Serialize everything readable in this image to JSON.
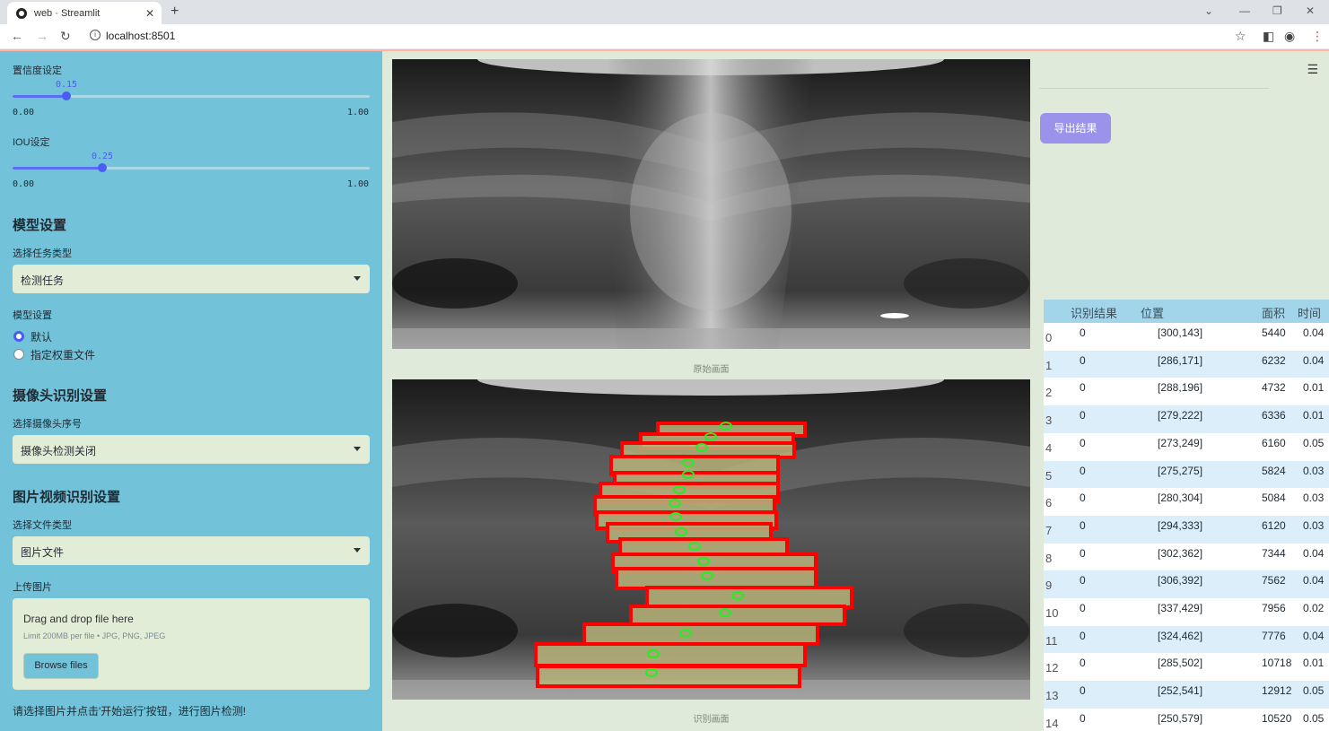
{
  "browser": {
    "tab_title": "web · Streamlit",
    "url": "localhost:8501"
  },
  "sidebar": {
    "conf_label": "置信度设定",
    "conf_value": "0.15",
    "conf_fraction": 0.15,
    "conf_min": "0.00",
    "conf_max": "1.00",
    "iou_label": "IOU设定",
    "iou_value": "0.25",
    "iou_fraction": 0.25,
    "iou_min": "0.00",
    "iou_max": "1.00",
    "model_header": "模型设置",
    "task_label": "选择任务类型",
    "task_value": "检测任务",
    "model_label": "模型设置",
    "model_options": [
      "默认",
      "指定权重文件"
    ],
    "camera_header": "摄像头识别设置",
    "camera_label": "选择摄像头序号",
    "camera_value": "摄像头检测关闭",
    "file_header": "图片视频识别设置",
    "file_type_label": "选择文件类型",
    "file_type_value": "图片文件",
    "upload_label": "上传图片",
    "dropzone_title": "Drag and drop file here",
    "dropzone_sub": "Limit 200MB per file • JPG, PNG, JPEG",
    "browse_label": "Browse files",
    "note": "请选择图片并点击'开始运行'按钮，进行图片检测!"
  },
  "main": {
    "caption_original": "原始画面",
    "caption_result": "识别画面",
    "export_label": "导出结果"
  },
  "table": {
    "headers": [
      "识别结果",
      "位置",
      "面积",
      "时间"
    ],
    "rows": [
      {
        "i": "0",
        "res": "0",
        "pos": "[300,143]",
        "area": "5440",
        "time": "0.04"
      },
      {
        "i": "1",
        "res": "0",
        "pos": "[286,171]",
        "area": "6232",
        "time": "0.04"
      },
      {
        "i": "2",
        "res": "0",
        "pos": "[288,196]",
        "area": "4732",
        "time": "0.01"
      },
      {
        "i": "3",
        "res": "0",
        "pos": "[279,222]",
        "area": "6336",
        "time": "0.01"
      },
      {
        "i": "4",
        "res": "0",
        "pos": "[273,249]",
        "area": "6160",
        "time": "0.05"
      },
      {
        "i": "5",
        "res": "0",
        "pos": "[275,275]",
        "area": "5824",
        "time": "0.03"
      },
      {
        "i": "6",
        "res": "0",
        "pos": "[280,304]",
        "area": "5084",
        "time": "0.03"
      },
      {
        "i": "7",
        "res": "0",
        "pos": "[294,333]",
        "area": "6120",
        "time": "0.03"
      },
      {
        "i": "8",
        "res": "0",
        "pos": "[302,362]",
        "area": "7344",
        "time": "0.04"
      },
      {
        "i": "9",
        "res": "0",
        "pos": "[306,392]",
        "area": "7562",
        "time": "0.04"
      },
      {
        "i": "10",
        "res": "0",
        "pos": "[337,429]",
        "area": "7956",
        "time": "0.02"
      },
      {
        "i": "11",
        "res": "0",
        "pos": "[324,462]",
        "area": "7776",
        "time": "0.04"
      },
      {
        "i": "12",
        "res": "0",
        "pos": "[285,502]",
        "area": "10718",
        "time": "0.01"
      },
      {
        "i": "13",
        "res": "0",
        "pos": "[252,541]",
        "area": "12912",
        "time": "0.05"
      },
      {
        "i": "14",
        "res": "0",
        "pos": "[250,579]",
        "area": "10520",
        "time": "0.05"
      }
    ]
  }
}
